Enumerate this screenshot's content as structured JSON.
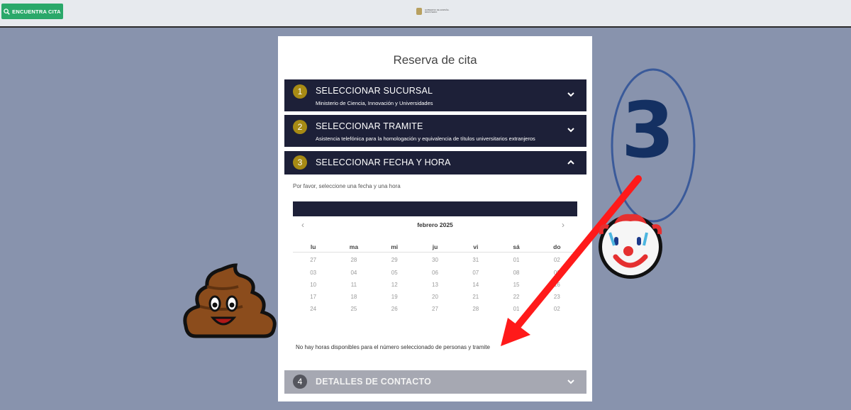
{
  "topbar": {
    "find_button_label": "ENCUENTRA CITA",
    "logo_text": "GOBIERNO DE ESPAÑA · MINISTERIO"
  },
  "card": {
    "title": "Reserva de cita"
  },
  "steps": [
    {
      "num": "1",
      "label": "SELECCIONAR SUCURSAL",
      "sub": "Ministerio de Ciencia, Innovación y Universidades"
    },
    {
      "num": "2",
      "label": "SELECCIONAR TRAMITE",
      "sub": "Asistencia telefónica para la homologación y equivalencia de títulos universitarios extranjeros"
    },
    {
      "num": "3",
      "label": "SELECCIONAR FECHA Y HORA"
    },
    {
      "num": "4",
      "label": "DETALLES DE CONTACTO"
    }
  ],
  "calendar": {
    "hint": "Por favor, seleccione una fecha y una hora",
    "month": "febrero 2025",
    "weekdays": [
      "lu",
      "ma",
      "mi",
      "ju",
      "vi",
      "sá",
      "do"
    ],
    "weeks": [
      [
        "27",
        "28",
        "29",
        "30",
        "31",
        "01",
        "02"
      ],
      [
        "03",
        "04",
        "05",
        "06",
        "07",
        "08",
        "09"
      ],
      [
        "10",
        "11",
        "12",
        "13",
        "14",
        "15",
        "16"
      ],
      [
        "17",
        "18",
        "19",
        "20",
        "21",
        "22",
        "23"
      ],
      [
        "24",
        "25",
        "26",
        "27",
        "28",
        "01",
        "02"
      ]
    ],
    "no_hours_message": "No hay horas disponibles para el número seleccionado de personas y tramite"
  },
  "annotations": {
    "circled_number": "3",
    "arrow_color": "#ff1a1a",
    "circle_color": "#3a5a9a",
    "emojis": [
      "pile-of-poo",
      "clown-face"
    ]
  },
  "colors": {
    "background": "#8893ad",
    "step_header": "#1d2038",
    "step_badge": "#a78a14",
    "button_green": "#2aa86a"
  }
}
